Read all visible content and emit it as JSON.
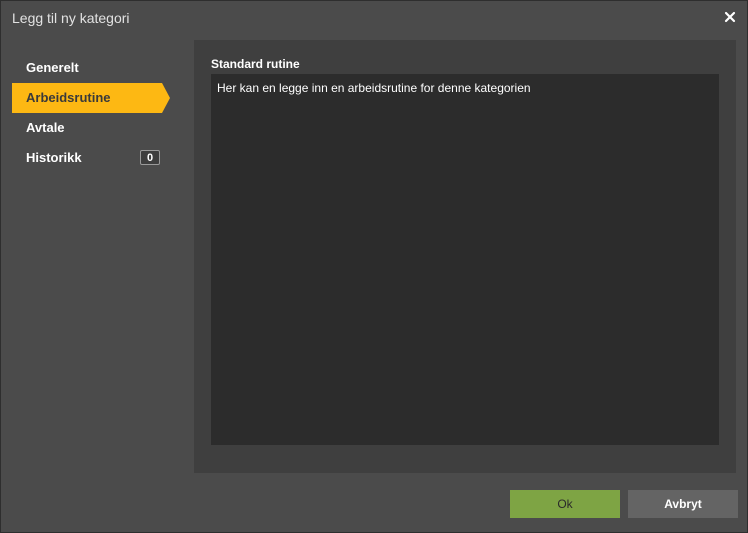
{
  "dialog": {
    "title": "Legg til ny kategori"
  },
  "sidebar": {
    "items": [
      {
        "label": "Generelt"
      },
      {
        "label": "Arbeidsrutine"
      },
      {
        "label": "Avtale"
      },
      {
        "label": "Historikk",
        "badge": "0"
      }
    ]
  },
  "routine": {
    "label": "Standard rutine",
    "text": "Her kan en legge inn en arbeidsrutine for denne kategorien"
  },
  "footer": {
    "ok_label": "Ok",
    "cancel_label": "Avbryt"
  },
  "colors": {
    "accent": "#fdb813",
    "ok": "#7ea444"
  },
  "icons": {
    "close": "close-icon"
  }
}
